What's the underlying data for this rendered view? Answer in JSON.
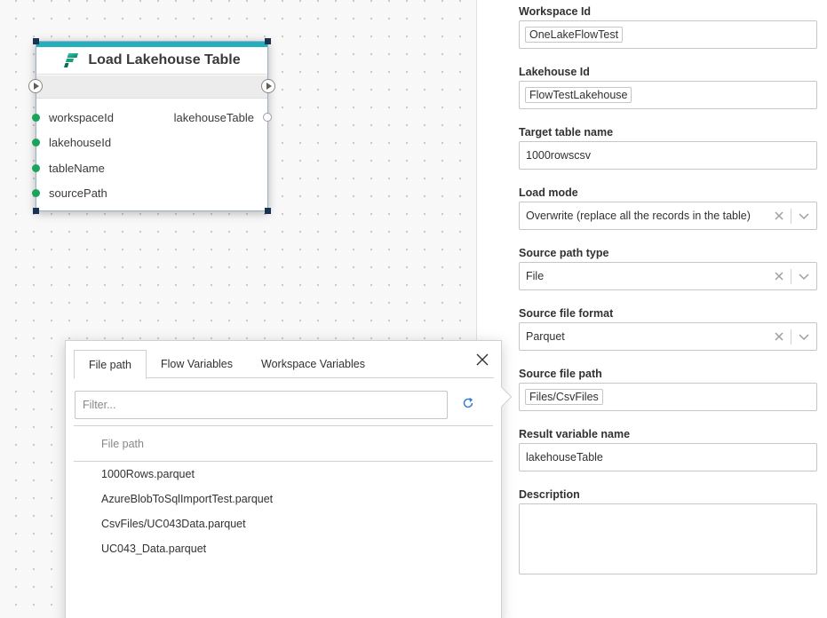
{
  "node": {
    "title": "Load Lakehouse Table",
    "inputs": [
      "workspaceId",
      "lakehouseId",
      "tableName",
      "sourcePath"
    ],
    "output": "lakehouseTable",
    "accent_color": "#23b0bc",
    "port_color": "#1aa35b",
    "icon": "fabric-logo-icon"
  },
  "popup": {
    "tabs": [
      "File path",
      "Flow Variables",
      "Workspace Variables"
    ],
    "active_tab": "File path",
    "filter": {
      "placeholder": "Filter...",
      "value": ""
    },
    "column_header": "File path",
    "files": [
      "1000Rows.parquet",
      "AzureBlobToSqlImportTest.parquet",
      "CsvFiles/UC043Data.parquet",
      "UC043_Data.parquet"
    ]
  },
  "properties": {
    "workspace_id": {
      "label": "Workspace Id",
      "value": "OneLakeFlowTest"
    },
    "lakehouse_id": {
      "label": "Lakehouse Id",
      "value": "FlowTestLakehouse"
    },
    "target_table": {
      "label": "Target table name",
      "value": "1000rowscsv"
    },
    "load_mode": {
      "label": "Load mode",
      "value": "Overwrite (replace all the records in the table)"
    },
    "source_path_type": {
      "label": "Source path type",
      "value": "File"
    },
    "source_file_format": {
      "label": "Source file format",
      "value": "Parquet"
    },
    "source_file_path": {
      "label": "Source file path",
      "value": "Files/CsvFiles"
    },
    "result_variable": {
      "label": "Result variable name",
      "value": "lakehouseTable"
    },
    "description": {
      "label": "Description",
      "value": ""
    }
  }
}
